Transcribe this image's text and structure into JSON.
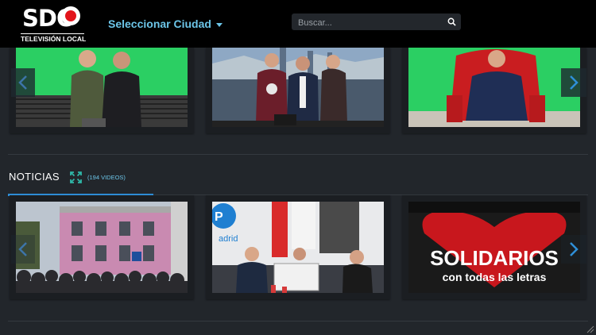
{
  "header": {
    "logo_text": "SDO",
    "logo_subtitle": "TELEVISIÓN LOCAL",
    "city_selector_label": "Seleccionar Ciudad",
    "search_placeholder": "Buscar...",
    "search_icon": "search-icon"
  },
  "top_carousel": {
    "items": [
      {
        "description": "two-men-green-screen"
      },
      {
        "description": "three-people-city-backdrop"
      },
      {
        "description": "man-red-chair-green-screen"
      }
    ]
  },
  "news": {
    "title": "NOTICIAS",
    "expand_icon": "expand-icon",
    "count_label": "(194 VIDEOS)",
    "items": [
      {
        "description": "crowd-in-plaza"
      },
      {
        "description": "press-conference",
        "logo_text": "adrid"
      },
      {
        "description": "solidarios-banner",
        "headline": "SOLIDARIOS",
        "subline": "con todas las letras"
      }
    ]
  },
  "colors": {
    "accent": "#6cc5e8",
    "active_tab": "#2f8fd8",
    "background": "#22262b",
    "header": "#000000",
    "logo_red": "#e3141b"
  }
}
